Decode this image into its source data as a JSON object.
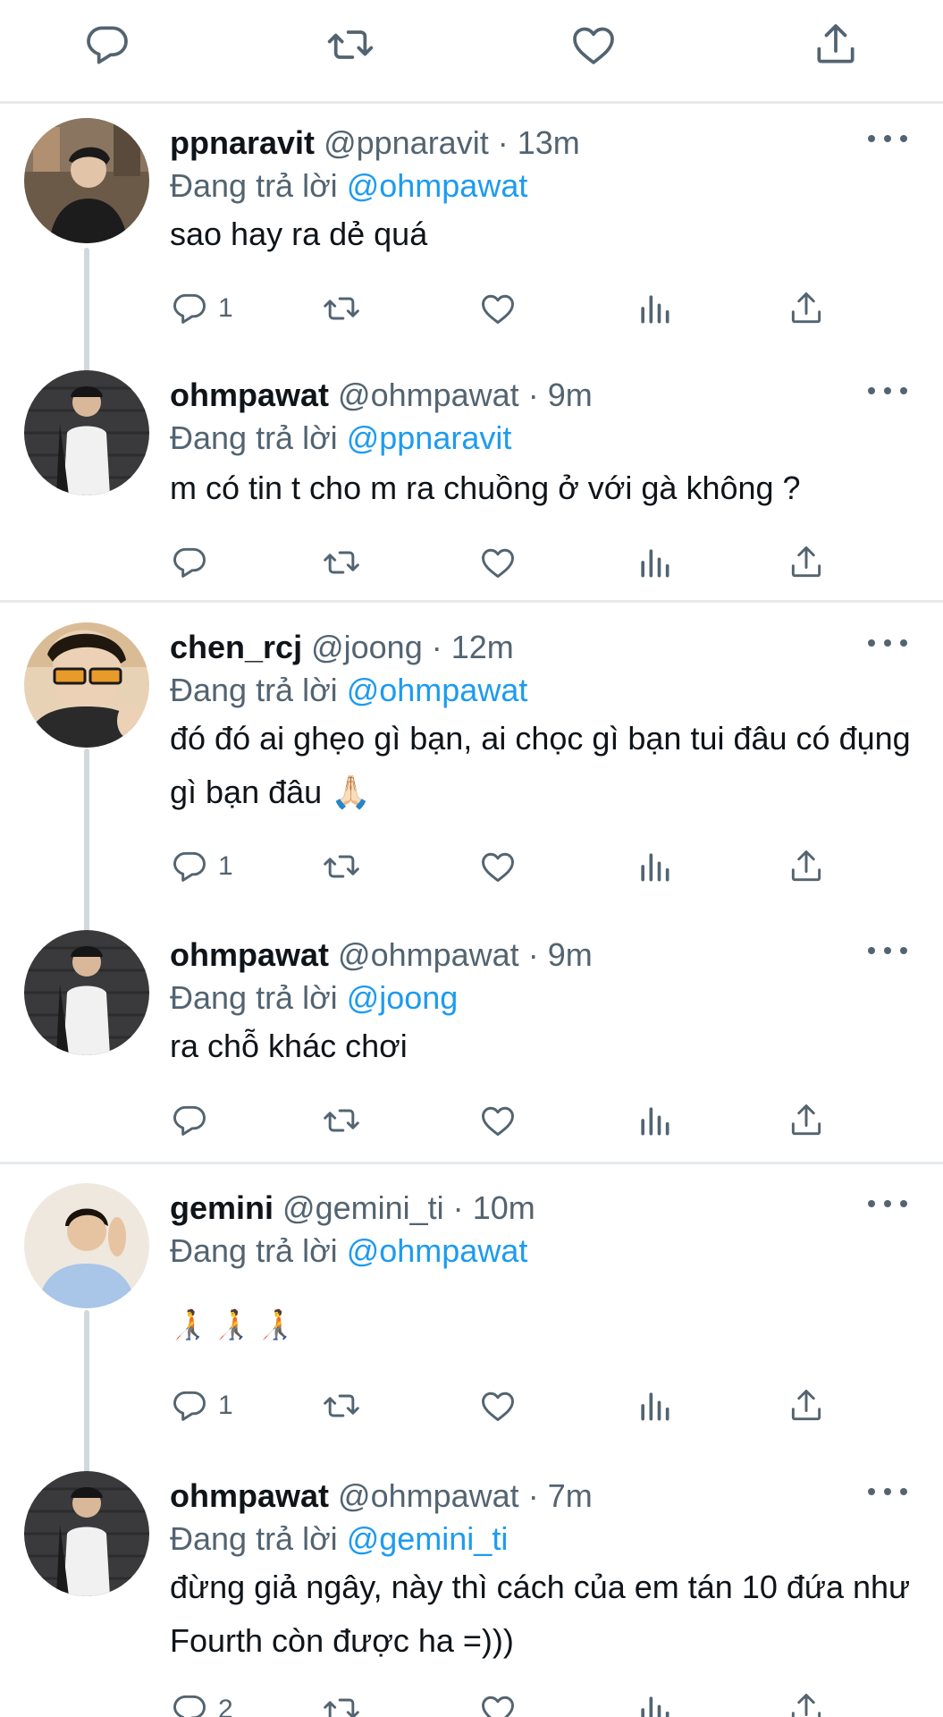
{
  "colors": {
    "text": "#0f1419",
    "muted": "#536471",
    "link": "#1d9bf0",
    "divider": "#e6e9ec",
    "thread_line": "#cfd9de"
  },
  "top_actions": [
    "reply-icon",
    "retweet-icon",
    "like-icon",
    "share-icon"
  ],
  "tweets": [
    {
      "name": "ppnaravit",
      "handle": "@ppnaravit",
      "dot": "·",
      "time": "13m",
      "reply_prefix": "Đang trả lời",
      "mention": "@ohmpawat",
      "text": "sao hay ra dẻ quá",
      "reply_count": "1"
    },
    {
      "name": "ohmpawat",
      "handle": "@ohmpawat",
      "dot": "·",
      "time": "9m",
      "reply_prefix": "Đang trả lời",
      "mention": "@ppnaravit",
      "text": "m có tin t cho m ra chuồng ở với gà không ?",
      "reply_count": ""
    },
    {
      "name": "chen_rcj",
      "handle": "@joong",
      "dot": "·",
      "time": "12m",
      "reply_prefix": "Đang trả lời",
      "mention": "@ohmpawat",
      "text": "đó đó ai ghẹo gì bạn, ai chọc gì bạn tui đâu có đụng gì bạn đâu 🙏🏻",
      "reply_count": "1"
    },
    {
      "name": "ohmpawat",
      "handle": "@ohmpawat",
      "dot": "·",
      "time": "9m",
      "reply_prefix": "Đang trả lời",
      "mention": "@joong",
      "text": "ra chỗ khác chơi",
      "reply_count": ""
    },
    {
      "name": "gemini",
      "handle": "@gemini_ti",
      "dot": "·",
      "time": "10m",
      "reply_prefix": "Đang trả lời",
      "mention": "@ohmpawat",
      "text": "🧑‍🦯 🧑‍🦯 🧑‍🦯",
      "reply_count": "1"
    },
    {
      "name": "ohmpawat",
      "handle": "@ohmpawat",
      "dot": "·",
      "time": "7m",
      "reply_prefix": "Đang trả lời",
      "mention": "@gemini_ti",
      "text": "đừng giả ngây, này thì cách của em tán 10 đứa như Fourth còn được ha =)))",
      "reply_count": "2"
    }
  ]
}
